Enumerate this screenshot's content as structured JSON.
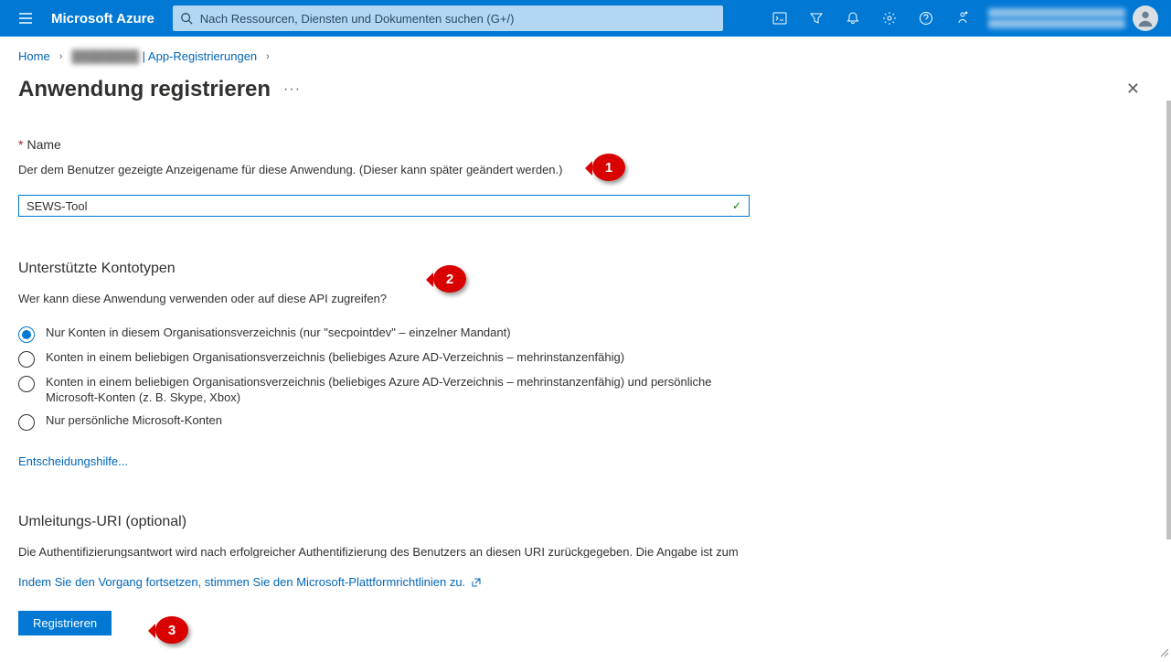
{
  "header": {
    "brand": "Microsoft Azure",
    "search_placeholder": "Nach Ressourcen, Diensten und Dokumenten suchen (G+/)"
  },
  "breadcrumb": {
    "home": "Home",
    "blurred": "████████",
    "item2_suffix": " | App-Registrierungen"
  },
  "page": {
    "title": "Anwendung registrieren"
  },
  "name_section": {
    "label": "Name",
    "desc": "Der dem Benutzer gezeigte Anzeigename für diese Anwendung. (Dieser kann später geändert werden.)",
    "value": "SEWS-Tool"
  },
  "account_types": {
    "heading": "Unterstützte Kontotypen",
    "desc": "Wer kann diese Anwendung verwenden oder auf diese API zugreifen?",
    "options": [
      "Nur Konten in diesem Organisationsverzeichnis (nur \"secpointdev\" – einzelner Mandant)",
      "Konten in einem beliebigen Organisationsverzeichnis (beliebiges Azure AD-Verzeichnis – mehrinstanzenfähig)",
      "Konten in einem beliebigen Organisationsverzeichnis (beliebiges Azure AD-Verzeichnis – mehrinstanzenfähig) und persönliche Microsoft-Konten (z. B. Skype, Xbox)",
      "Nur persönliche Microsoft-Konten"
    ],
    "selected_index": 0,
    "help": "Entscheidungshilfe..."
  },
  "redirect_uri": {
    "heading": "Umleitungs-URI (optional)",
    "desc": "Die Authentifizierungsantwort wird nach erfolgreicher Authentifizierung des Benutzers an diesen URI zurückgegeben. Die Angabe ist zum jetzigen Zeitpunkt optional und kann später geändert werden. Für die meisten Authentifizierungsszenarien ist jedoch ein Wert erforderlich."
  },
  "footer": {
    "consent": "Indem Sie den Vorgang fortsetzen, stimmen Sie den Microsoft-Plattformrichtlinien zu.",
    "register": "Registrieren"
  },
  "annotations": {
    "1": "1",
    "2": "2",
    "3": "3"
  },
  "colors": {
    "primary": "#0078d4",
    "danger": "#d90000",
    "success": "#107c10"
  }
}
